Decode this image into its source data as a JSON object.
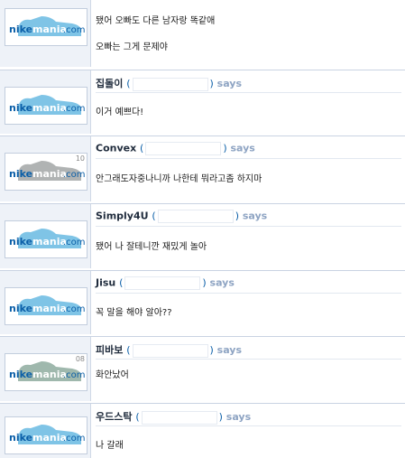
{
  "brand": {
    "prefix": "nike",
    "middle": "mania",
    "suffix": ".com"
  },
  "colors": {
    "brand_blue": "#0b5fa8",
    "shoe_blue": "#7fc4e6",
    "shoe_gray": "#b0b3b3",
    "shoe_sage": "#9fb8ad",
    "says_gray": "#8ea4c3"
  },
  "comments": [
    {
      "nick": "",
      "says": "",
      "text_lines": [
        "됐어 오빠도 다른 남자랑 똑같애",
        "오빠는 그게 문제야"
      ],
      "shoe": "blue",
      "badge": ""
    },
    {
      "nick": "집돌이",
      "says": "says",
      "text_lines": [
        "이거 예쁘다!"
      ],
      "shoe": "blue",
      "badge": ""
    },
    {
      "nick": "Convex",
      "says": "says",
      "text_lines": [
        "안그래도자중나니까 나한테 뭐라고좀 하지마"
      ],
      "shoe": "gray",
      "badge": "10"
    },
    {
      "nick": "Simply4U",
      "says": "says",
      "text_lines": [
        "됐어 나 잘테니깐 재밌게 놀아"
      ],
      "shoe": "blue",
      "badge": ""
    },
    {
      "nick": "Jisu",
      "says": "says",
      "text_lines": [
        "꼭 말을 해야 알아??"
      ],
      "shoe": "blue",
      "badge": ""
    },
    {
      "nick": "피바보",
      "says": "says",
      "text_lines": [
        "화안났어"
      ],
      "shoe": "sage",
      "badge": "08"
    },
    {
      "nick": "우드스탁",
      "says": "says",
      "text_lines": [
        "나 갈래"
      ],
      "shoe": "blue",
      "badge": ""
    }
  ]
}
